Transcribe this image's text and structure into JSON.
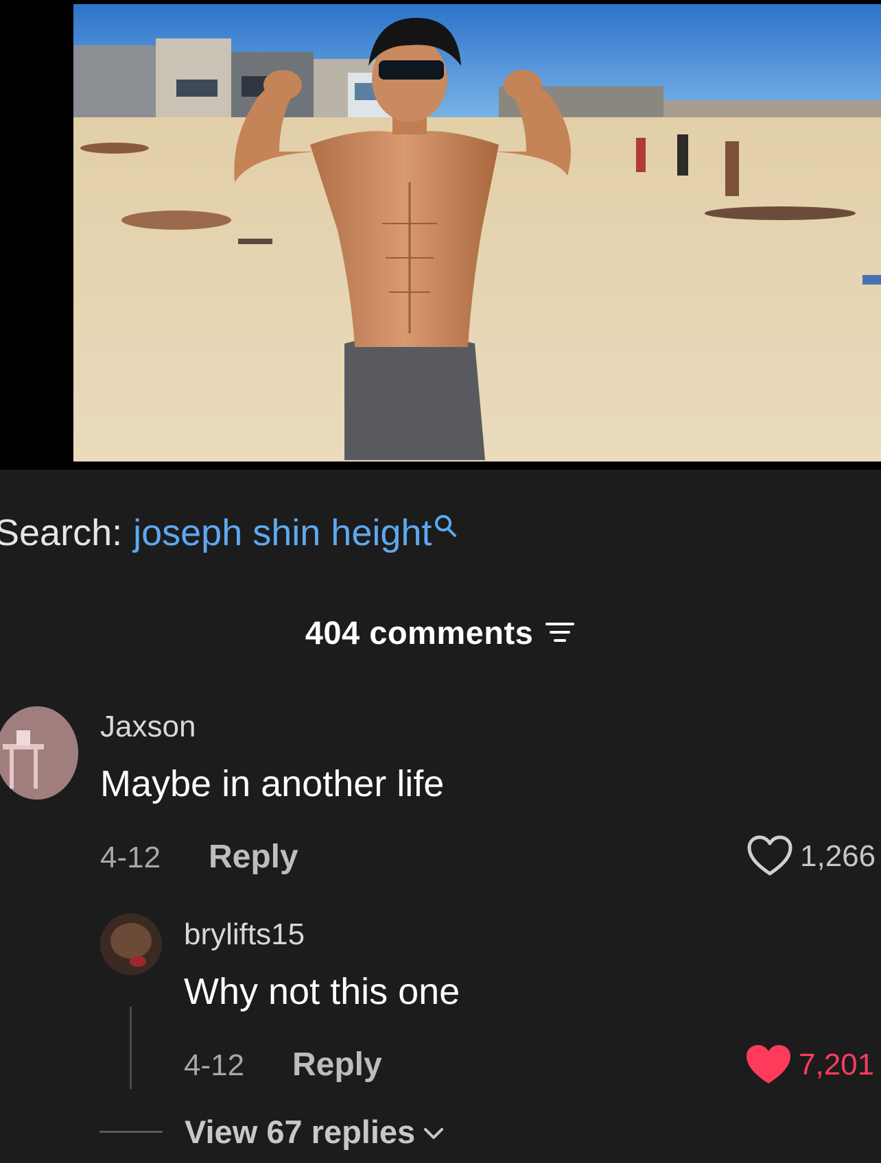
{
  "search": {
    "prefix": "Search:",
    "query": "joseph shin height"
  },
  "comments": {
    "count_label": "404 comments"
  },
  "thread": [
    {
      "username": "Jaxson",
      "text": "Maybe in another life",
      "date": "4-12",
      "reply_label": "Reply",
      "likes": "1,266",
      "liked": false
    },
    {
      "username": "brylifts15",
      "text": "Why not this one",
      "date": "4-12",
      "reply_label": "Reply",
      "likes": "7,201",
      "liked": true
    }
  ],
  "view_replies_label": "View 67 replies",
  "colors": {
    "background": "#1c1c1d",
    "link_blue": "#5fa8f0",
    "liked_red": "#ff3b5c"
  },
  "icons": [
    "search-icon",
    "filter-icon",
    "heart-outline-icon",
    "heart-filled-icon",
    "chevron-down-icon"
  ]
}
